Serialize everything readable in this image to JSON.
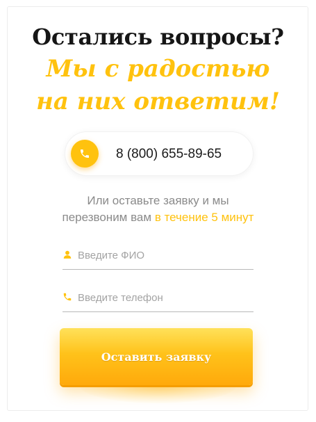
{
  "heading": {
    "title": "Остались вопросы?",
    "subtitle_line1": "Мы с радостью",
    "subtitle_line2": "на них ответим!"
  },
  "contact": {
    "phone_number": "8 (800) 655-89-65",
    "phone_icon": "phone-icon"
  },
  "callback_note": {
    "line1": "Или оставьте заявку и мы",
    "line2_prefix": "перезвоним вам",
    "line2_highlight": "в течение 5 минут"
  },
  "form": {
    "name_field": {
      "placeholder": "Введите ФИО",
      "value": "",
      "icon": "user-icon"
    },
    "phone_field": {
      "placeholder": "Введите телефон",
      "value": "",
      "icon": "phone-icon"
    },
    "submit_label": "Оставить заявку"
  },
  "colors": {
    "accent": "#ffc20e",
    "title": "#161616",
    "muted_text": "#8a8a8a",
    "button_top": "#ffe15a",
    "button_bottom": "#ffa90b"
  }
}
